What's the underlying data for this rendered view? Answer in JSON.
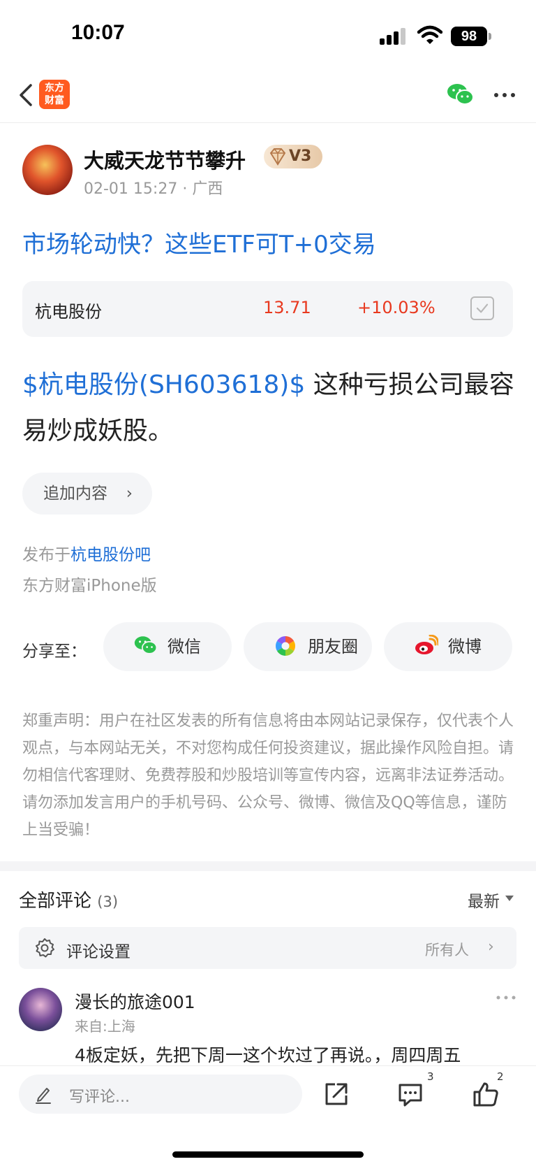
{
  "status_bar": {
    "time": "10:07",
    "battery": "98"
  },
  "navbar": {
    "logo_text": "东方财富"
  },
  "post": {
    "author": "大威天龙节节攀升",
    "level": "V3",
    "date": "02-01 15:27",
    "location": "· 广西",
    "title": "市场轮动快？这些ETF可T+0交易",
    "stock_card": {
      "name": "杭电股份",
      "price": "13.71",
      "change": "+10.03%"
    },
    "body_link": "$杭电股份(SH603618)$",
    "body_text": "  这种亏损公司最容易炒成妖股。",
    "append_label": "追加内容",
    "published_prefix": "发布于",
    "forum_name": "杭电股份吧",
    "client": "东方财富iPhone版"
  },
  "share": {
    "label": "分享至：",
    "wechat": "微信",
    "moments": "朋友圈",
    "weibo": "微博"
  },
  "disclaimer": "郑重声明：用户在社区发表的所有信息将由本网站记录保存，仅代表个人观点，与本网站无关，不对您构成任何投资建议，据此操作风险自担。请勿相信代客理财、免费荐股和炒股培训等宣传内容，远离非法证券活动。请勿添加发言用户的手机号码、公众号、微博、微信及QQ等信息，谨防上当受骗！",
  "comments": {
    "title": "全部评论",
    "count": "(3)",
    "sort": "最新",
    "settings_label": "评论设置",
    "settings_value": "所有人",
    "items": [
      {
        "name": "漫长的旅途001",
        "location": "来自:上海",
        "text": "4板定妖，先把下周一这个坎过了再说。，周四周五"
      }
    ]
  },
  "bottom_bar": {
    "input_placeholder": "写评论...",
    "comment_count": "3",
    "like_count": "2"
  },
  "colors": {
    "link": "#1f6fd6",
    "up": "#e8391f",
    "brand": "#ff5a1f"
  }
}
